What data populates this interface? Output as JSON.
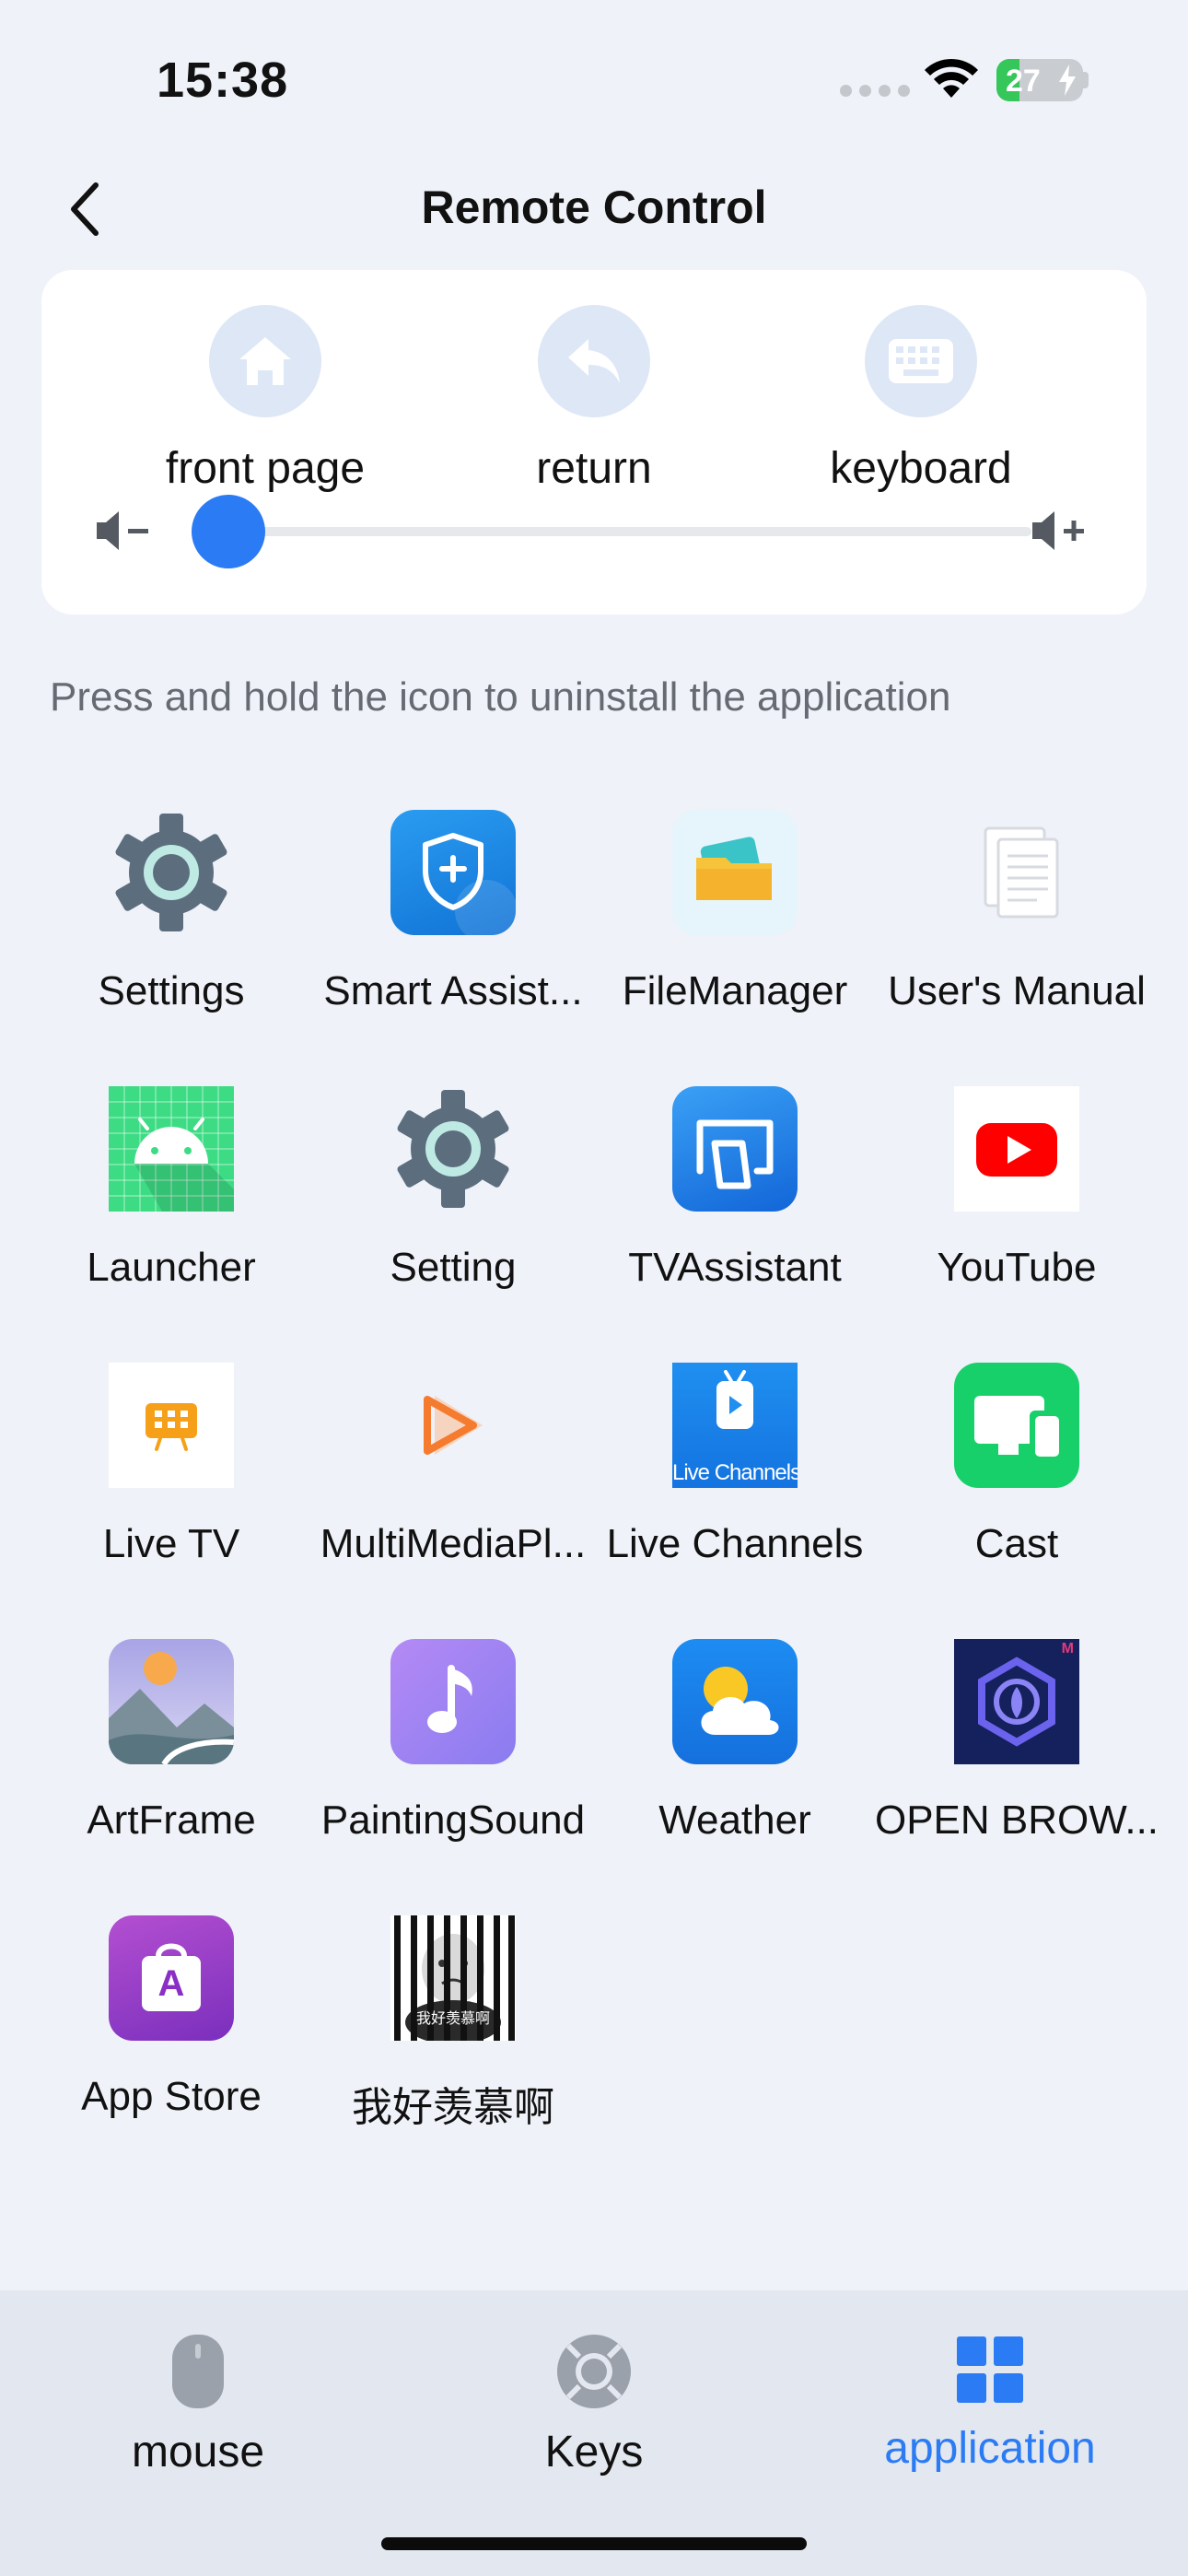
{
  "status": {
    "time": "15:38",
    "battery": "27",
    "battery_level": 0.27
  },
  "header": {
    "title": "Remote Control"
  },
  "controls": {
    "home_label": "front page",
    "return_label": "return",
    "keyboard_label": "keyboard",
    "volume_level": 0.0
  },
  "hint": "Press and hold the icon to uninstall the application",
  "apps": [
    {
      "label": "Settings",
      "icon": "settings-gear-icon"
    },
    {
      "label": "Smart Assist...",
      "icon": "shield-plus-icon"
    },
    {
      "label": "FileManager",
      "icon": "folder-icon"
    },
    {
      "label": "User's Manual",
      "icon": "document-icon"
    },
    {
      "label": "Launcher",
      "icon": "android-icon"
    },
    {
      "label": "Setting",
      "icon": "settings-gear-icon"
    },
    {
      "label": "TVAssistant",
      "icon": "cast-screen-icon"
    },
    {
      "label": "YouTube",
      "icon": "youtube-icon"
    },
    {
      "label": "Live TV",
      "icon": "live-tv-icon"
    },
    {
      "label": "MultiMediaPl...",
      "icon": "play-icon"
    },
    {
      "label": "Live Channels",
      "icon": "live-channels-icon",
      "icon_text": "Live Channels"
    },
    {
      "label": "Cast",
      "icon": "devices-icon"
    },
    {
      "label": "ArtFrame",
      "icon": "landscape-icon"
    },
    {
      "label": "PaintingSound",
      "icon": "music-note-icon"
    },
    {
      "label": "Weather",
      "icon": "weather-icon"
    },
    {
      "label": "OPEN BROW...",
      "icon": "browser-icon",
      "icon_text": "M"
    },
    {
      "label": "App Store",
      "icon": "app-store-icon",
      "icon_text": "A"
    },
    {
      "label": "我好羡慕啊",
      "icon": "meme-image-icon",
      "icon_text": "我好羡慕啊"
    }
  ],
  "tabs": [
    {
      "label": "mouse",
      "icon": "mouse-icon",
      "active": false
    },
    {
      "label": "Keys",
      "icon": "dpad-icon",
      "active": false
    },
    {
      "label": "application",
      "icon": "grid-icon",
      "active": true
    }
  ],
  "colors": {
    "accent": "#2b7bf4",
    "background": "#eff2f8",
    "card": "#ffffff",
    "tab_bar": "#e3e7ef"
  }
}
